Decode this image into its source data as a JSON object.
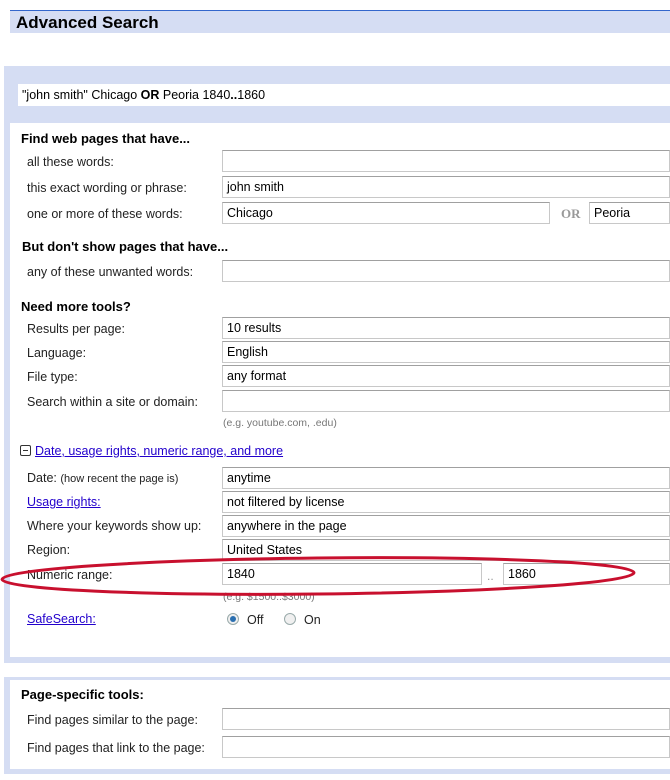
{
  "header": {
    "title": "Advanced Search"
  },
  "query": {
    "part1": "\"john smith\" Chicago ",
    "or": "OR",
    "part2": " Peoria 1840",
    "range_sep": "..",
    "part3": "1860"
  },
  "find_section": {
    "title": "Find web pages that have...",
    "all_words_label": "all these words:",
    "all_words_value": "",
    "exact_label": "this exact wording or phrase:",
    "exact_value": "john smith",
    "one_or_more_label": "one or more of these words:",
    "one_or_more_value1": "Chicago",
    "or_label": "OR",
    "one_or_more_value2": "Peoria"
  },
  "exclude_section": {
    "title": "But don't show pages that have...",
    "unwanted_label": "any of these unwanted words:",
    "unwanted_value": ""
  },
  "tools_section": {
    "title": "Need more tools?",
    "results_label": "Results per page:",
    "results_value": "10 results",
    "language_label": "Language:",
    "language_value": "English",
    "filetype_label": "File type:",
    "filetype_value": "any format",
    "site_label": "Search within a site or domain:",
    "site_value": "",
    "site_hint": "(e.g. youtube.com, .edu)"
  },
  "more_section": {
    "toggle_label": "Date, usage rights, numeric range, and more",
    "date_label": "Date:",
    "date_sublabel": "(how recent the page is)",
    "date_value": "anytime",
    "usage_label": "Usage rights:",
    "usage_value": "not filtered by license",
    "where_label": "Where your keywords show up:",
    "where_value": "anywhere in the page",
    "region_label": "Region:",
    "region_value": "United States",
    "numeric_label": "Numeric range:",
    "numeric_from": "1840",
    "numeric_sep": "..",
    "numeric_to": "1860",
    "numeric_hint": "(e.g. $1500..$3000)",
    "safesearch_label": "SafeSearch:",
    "safesearch_off": "Off",
    "safesearch_on": "On",
    "safesearch_selected": "Off"
  },
  "page_tools": {
    "title": "Page-specific tools:",
    "similar_label": "Find pages similar to the page:",
    "similar_value": "",
    "link_label": "Find pages that link to the page:",
    "link_value": ""
  },
  "annotation": {
    "color": "#c8102e"
  }
}
